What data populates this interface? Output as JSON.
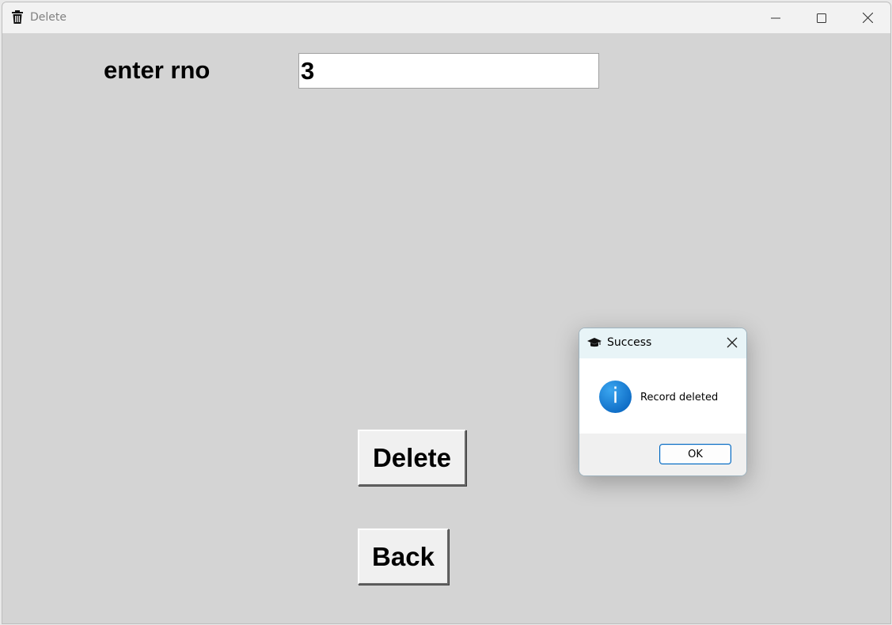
{
  "window": {
    "title": "Delete",
    "icon": "trash-icon",
    "controls": [
      "minimize-icon",
      "maximize-icon",
      "close-icon"
    ]
  },
  "form": {
    "rno_label": "enter rno",
    "rno_value": "3",
    "delete_label": "Delete",
    "back_label": "Back"
  },
  "dialog": {
    "title": "Success",
    "title_icon": "graduation-cap-icon",
    "message": "Record deleted",
    "message_icon": "info-icon",
    "ok_label": "OK"
  },
  "colors": {
    "window_background": "#d4d4d4",
    "dialog_accent": "#0067c0",
    "info_icon": "#1a7fd4"
  }
}
